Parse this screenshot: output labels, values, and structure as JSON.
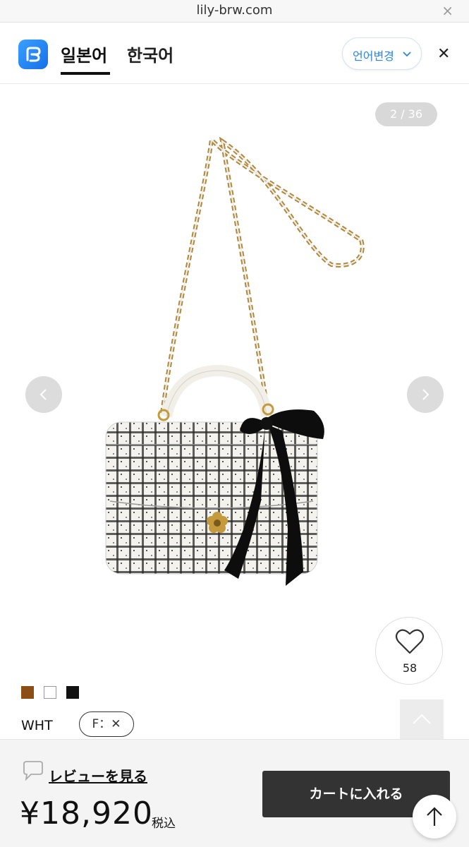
{
  "browser": {
    "url": "lily-brw.com",
    "close_glyph": "×"
  },
  "translate_bar": {
    "tabs": [
      {
        "label": "일본어",
        "active": true
      },
      {
        "label": "한국어",
        "active": false
      }
    ],
    "language_button": "언어변경",
    "close_glyph": "✕",
    "logo_icon": "translate-app-logo"
  },
  "gallery": {
    "counter": "2 / 36",
    "prev_icon": "chevron-left-icon",
    "next_icon": "chevron-right-icon"
  },
  "like": {
    "count": "58",
    "icon": "heart-outline-icon"
  },
  "colors": {
    "swatches": [
      {
        "name": "brown",
        "hex": "#8b4f16"
      },
      {
        "name": "white",
        "hex": "#ffffff"
      },
      {
        "name": "black",
        "hex": "#111111"
      }
    ],
    "selected_name": "WHT"
  },
  "size": {
    "label": "F：✕"
  },
  "bottom_bar": {
    "review_link": "レビューを見る",
    "price": "¥18,920",
    "tax_label": "税込",
    "cart_button": "カートに入れる"
  },
  "accent_color": "#2a86e0"
}
